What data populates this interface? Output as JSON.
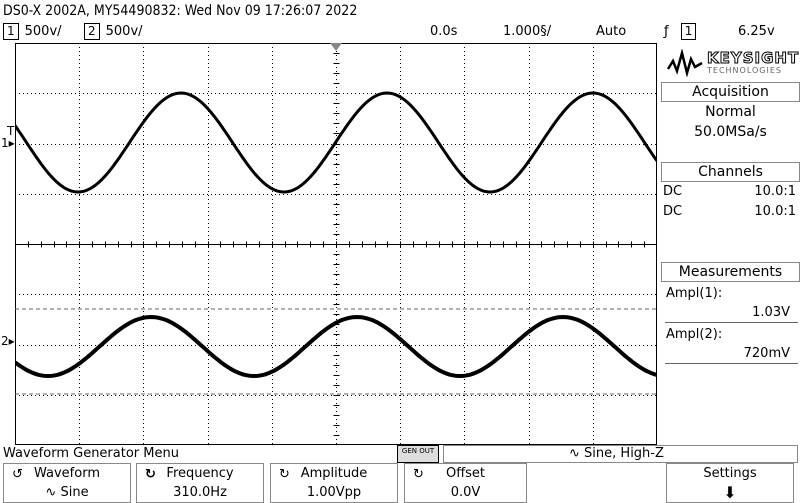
{
  "title": "DS0-X 2002A, MY54490832: Wed Nov 09 17:26:07 2022",
  "status": {
    "ch1_num": "1",
    "ch1_scale": "500ⅴ/",
    "ch2_num": "2",
    "ch2_scale": "500ⅴ/",
    "time_delay": "0.0s",
    "time_scale": "1.000§/",
    "trigger_mode": "Auto",
    "trigger_source": "1",
    "trigger_level": "6.25ⅴ"
  },
  "markers": {
    "trigger_marker": "T",
    "ch1_marker": "1",
    "ch2_marker": "2"
  },
  "brand": {
    "name": "KEYSIGHT",
    "sub": "TECHNOLOGIES"
  },
  "acquisition": {
    "header": "Acquisition",
    "mode": "Normal",
    "rate": "50.0MSa/s"
  },
  "channels": {
    "header": "Channels",
    "rows": [
      {
        "coupling": "DC",
        "probe": "10.0:1"
      },
      {
        "coupling": "DC",
        "probe": "10.0:1"
      }
    ]
  },
  "measurements": {
    "header": "Measurements",
    "items": [
      {
        "label": "Ampl(1):",
        "value": "1.03V"
      },
      {
        "label": "Ampl(2):",
        "value": "720mV"
      }
    ]
  },
  "menu": {
    "title": "Waveform Generator Menu",
    "gen_out": "GEN OUT",
    "gen_status": "Sine, High-Z"
  },
  "softkeys": [
    {
      "label": "Waveform",
      "value": "Sine"
    },
    {
      "label": "Frequency",
      "value": "310.0Hz"
    },
    {
      "label": "Amplitude",
      "value": "1.00Vpp"
    },
    {
      "label": "Offset",
      "value": "0.0V"
    },
    {
      "label": "Settings",
      "value": ""
    }
  ],
  "colors": {
    "trace": "#000000",
    "grid": "#000000",
    "panel_border": "#888888"
  }
}
